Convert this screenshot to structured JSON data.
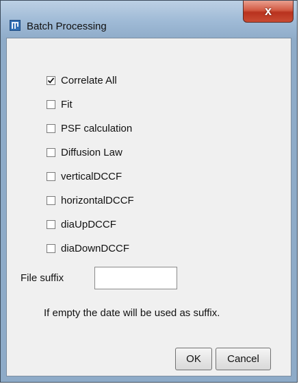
{
  "window": {
    "title": "Batch Processing",
    "close_glyph": "x"
  },
  "checkboxes": [
    {
      "label": "Correlate All",
      "checked": true
    },
    {
      "label": "Fit",
      "checked": false
    },
    {
      "label": "PSF calculation",
      "checked": false
    },
    {
      "label": "Diffusion Law",
      "checked": false
    },
    {
      "label": "verticalDCCF",
      "checked": false
    },
    {
      "label": "horizontalDCCF",
      "checked": false
    },
    {
      "label": "diaUpDCCF",
      "checked": false
    },
    {
      "label": "diaDownDCCF",
      "checked": false
    }
  ],
  "file_suffix": {
    "label": "File suffix",
    "value": ""
  },
  "hint": "If empty the date will be used as suffix.",
  "buttons": {
    "ok": "OK",
    "cancel": "Cancel"
  },
  "icons": {
    "app": "imagej-app-icon",
    "close": "close-icon",
    "check": "checkmark-icon"
  }
}
